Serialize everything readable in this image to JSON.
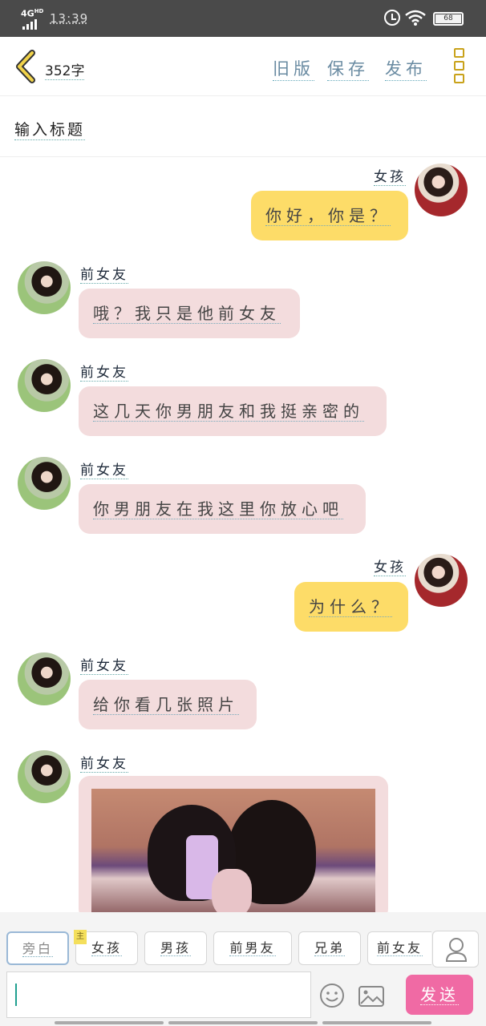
{
  "status_bar": {
    "network": "4G",
    "network_super": "HD",
    "time": "13:39",
    "battery": "68"
  },
  "header": {
    "char_count": "352字",
    "actions": [
      "旧版",
      "保存",
      "发布"
    ]
  },
  "title_input": {
    "placeholder": "输入标题"
  },
  "messages": [
    {
      "side": "right",
      "name": "女孩",
      "text": "你好，你是？"
    },
    {
      "side": "left",
      "name": "前女友",
      "text": "哦？我只是他前女友"
    },
    {
      "side": "left",
      "name": "前女友",
      "text": "这几天你男朋友和我挺亲密的"
    },
    {
      "side": "left",
      "name": "前女友",
      "text": "你男朋友在我这里你放心吧"
    },
    {
      "side": "right",
      "name": "女孩",
      "text": "为什么？"
    },
    {
      "side": "left",
      "name": "前女友",
      "text": "给你看几张照片"
    },
    {
      "side": "left",
      "name": "前女友",
      "text": ""
    }
  ],
  "roles": [
    {
      "label": "旁白",
      "active": true
    },
    {
      "label": "女孩",
      "badge": "主"
    },
    {
      "label": "男孩"
    },
    {
      "label": "前男友"
    },
    {
      "label": "兄弟"
    },
    {
      "label": "前女友"
    }
  ],
  "composer": {
    "value": "",
    "send_label": "发送"
  },
  "colors": {
    "right_bubble": "#fddc68",
    "left_bubble": "#f3dcdd",
    "send": "#f06aa4",
    "accent": "#c9a21a"
  }
}
